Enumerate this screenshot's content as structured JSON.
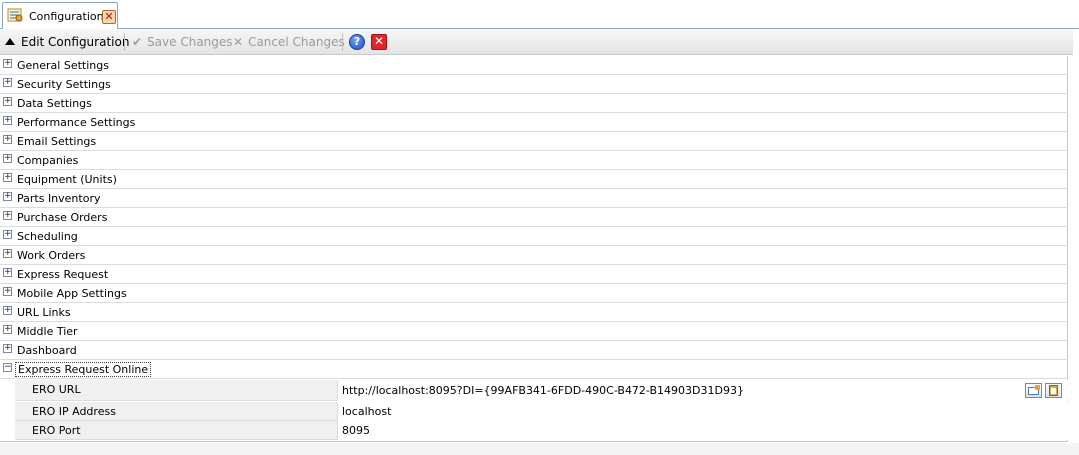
{
  "tab": {
    "label": "Configuration",
    "close_glyph": "✕",
    "icon": "config-icon"
  },
  "toolbar": {
    "edit_label": "Edit Configuration",
    "save_label": "Save Changes",
    "cancel_label": "Cancel Changes",
    "save_glyph": "✔",
    "cancel_glyph": "✕",
    "help_glyph": "?",
    "close_glyph": "✕"
  },
  "sections": [
    {
      "label": "General Settings",
      "expanded": false
    },
    {
      "label": "Security Settings",
      "expanded": false
    },
    {
      "label": "Data Settings",
      "expanded": false
    },
    {
      "label": "Performance Settings",
      "expanded": false
    },
    {
      "label": "Email Settings",
      "expanded": false
    },
    {
      "label": "Companies",
      "expanded": false
    },
    {
      "label": "Equipment (Units)",
      "expanded": false
    },
    {
      "label": "Parts Inventory",
      "expanded": false
    },
    {
      "label": "Purchase Orders",
      "expanded": false
    },
    {
      "label": "Scheduling",
      "expanded": false
    },
    {
      "label": "Work Orders",
      "expanded": false
    },
    {
      "label": "Express Request",
      "expanded": false
    },
    {
      "label": "Mobile App Settings",
      "expanded": false
    },
    {
      "label": "URL Links",
      "expanded": false
    },
    {
      "label": "Middle Tier",
      "expanded": false
    },
    {
      "label": "Dashboard",
      "expanded": false
    },
    {
      "label": "Express Request Online",
      "expanded": true
    }
  ],
  "toggle_glyphs": {
    "collapsed": "+",
    "expanded": "−"
  },
  "ero_properties": [
    {
      "name": "ERO URL",
      "value": "http://localhost:8095?DI={99AFB341-6FDD-490C-B472-B14903D31D93}"
    },
    {
      "name": "ERO IP Address",
      "value": "localhost"
    },
    {
      "name": "ERO Port",
      "value": "8095"
    }
  ],
  "colors": {
    "toolbar_disabled_text": "#9a9a9a",
    "help_blue": "#1a4fc4",
    "close_red": "#e0262c"
  }
}
